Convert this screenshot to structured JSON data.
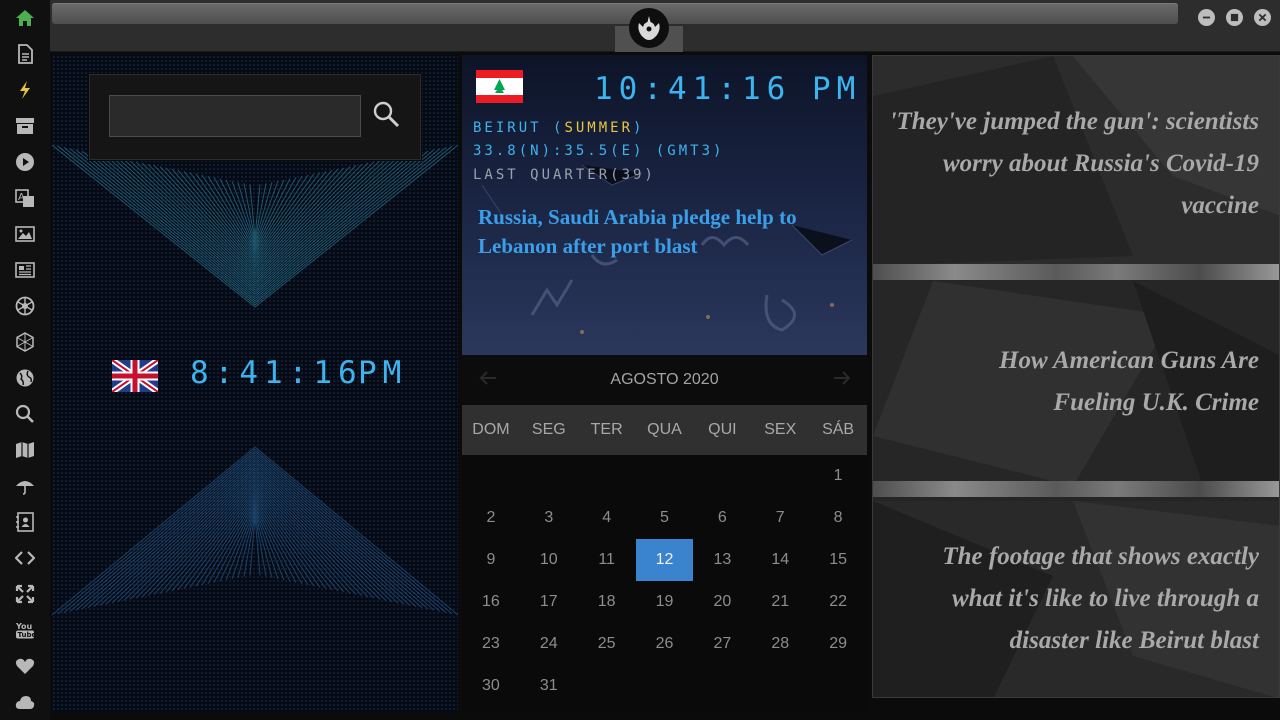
{
  "sidebar": {
    "icons": [
      "home-icon",
      "document-icon",
      "lightning-icon",
      "archive-icon",
      "play-icon",
      "translate-icon",
      "image-icon",
      "newspaper-icon",
      "rebel-emblem-icon",
      "hexagon-icon",
      "globe-icon",
      "search-icon",
      "map-icon",
      "umbrella-icon",
      "contacts-icon",
      "code-icon",
      "expand-icon",
      "youtube-icon",
      "heart-icon",
      "cloud-icon"
    ],
    "active_color": "#4caf50",
    "accent_color": "#e6c640"
  },
  "titlebar": {
    "logo": "rebel-alliance-logo",
    "controls": [
      "minimize",
      "maximize",
      "close"
    ]
  },
  "search": {
    "value": "",
    "placeholder": ""
  },
  "uk_clock": {
    "time": "8:41:16",
    "ampm": "PM",
    "flag": "united-kingdom-flag"
  },
  "beirut": {
    "time": "10:41:16",
    "ampm": "PM",
    "flag": "lebanon-flag",
    "city": "BEIRUT",
    "season": "SUMMER",
    "coordinates": "33.8(N):35.5(E) (GMT3)",
    "moon_phase": "LAST QUARTER(39)",
    "headline": "Russia, Saudi Arabia pledge help to Lebanon after port blast"
  },
  "calendar": {
    "title": "AGOSTO 2020",
    "weekdays": [
      "DOM",
      "SEG",
      "TER",
      "QUA",
      "QUI",
      "SEX",
      "SÁB"
    ],
    "weeks": [
      [
        "",
        "",
        "",
        "",
        "",
        "",
        "1"
      ],
      [
        "2",
        "3",
        "4",
        "5",
        "6",
        "7",
        "8"
      ],
      [
        "9",
        "10",
        "11",
        "12",
        "13",
        "14",
        "15"
      ],
      [
        "16",
        "17",
        "18",
        "19",
        "20",
        "21",
        "22"
      ],
      [
        "23",
        "24",
        "25",
        "26",
        "27",
        "28",
        "29"
      ],
      [
        "30",
        "31",
        "",
        "",
        "",
        "",
        ""
      ]
    ],
    "today": "12",
    "today_color": "#3a83cf"
  },
  "news": [
    "'They've jumped the gun': scientists worry about Russia's Covid-19 vaccine",
    "How American Guns Are Fueling U.K. Crime",
    "The footage that shows exactly what it's like to live through a disaster like Beirut blast"
  ]
}
